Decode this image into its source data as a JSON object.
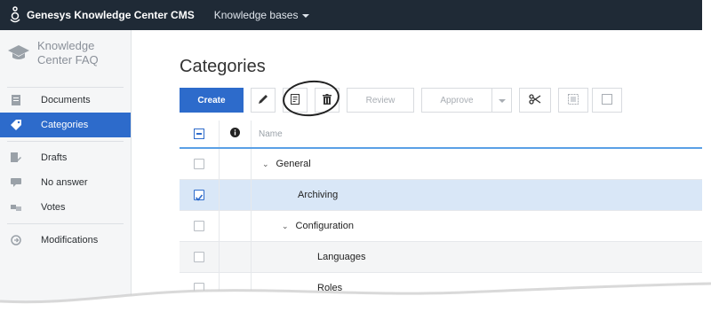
{
  "app": {
    "title": "Genesys Knowledge Center CMS",
    "menu_label": "Knowledge bases"
  },
  "sidebar": {
    "kb_title_line1": "Knowledge",
    "kb_title_line2": "Center FAQ",
    "items": [
      {
        "label": "Documents",
        "icon": "document-icon",
        "active": false
      },
      {
        "label": "Categories",
        "icon": "tag-icon",
        "active": true
      },
      {
        "label": "Drafts",
        "icon": "drafts-icon",
        "active": false
      },
      {
        "label": "No answer",
        "icon": "chat-icon",
        "active": false
      },
      {
        "label": "Votes",
        "icon": "votes-icon",
        "active": false
      },
      {
        "label": "Modifications",
        "icon": "history-icon",
        "active": false
      }
    ]
  },
  "main": {
    "title": "Categories",
    "toolbar": {
      "create_label": "Create",
      "review_label": "Review",
      "approve_label": "Approve"
    },
    "table": {
      "header_name": "Name",
      "rows": [
        {
          "name": "General",
          "level": 0,
          "expanded": true,
          "checked": false
        },
        {
          "name": "Archiving",
          "level": 1,
          "expanded": false,
          "checked": true
        },
        {
          "name": "Configuration",
          "level": 1,
          "expanded": true,
          "checked": false
        },
        {
          "name": "Languages",
          "level": 2,
          "expanded": false,
          "checked": false
        },
        {
          "name": "Roles",
          "level": 2,
          "expanded": false,
          "checked": false
        }
      ]
    }
  },
  "colors": {
    "topbar": "#1f2a36",
    "accent": "#2d6bcb",
    "selected_row": "#d9e7f7"
  }
}
